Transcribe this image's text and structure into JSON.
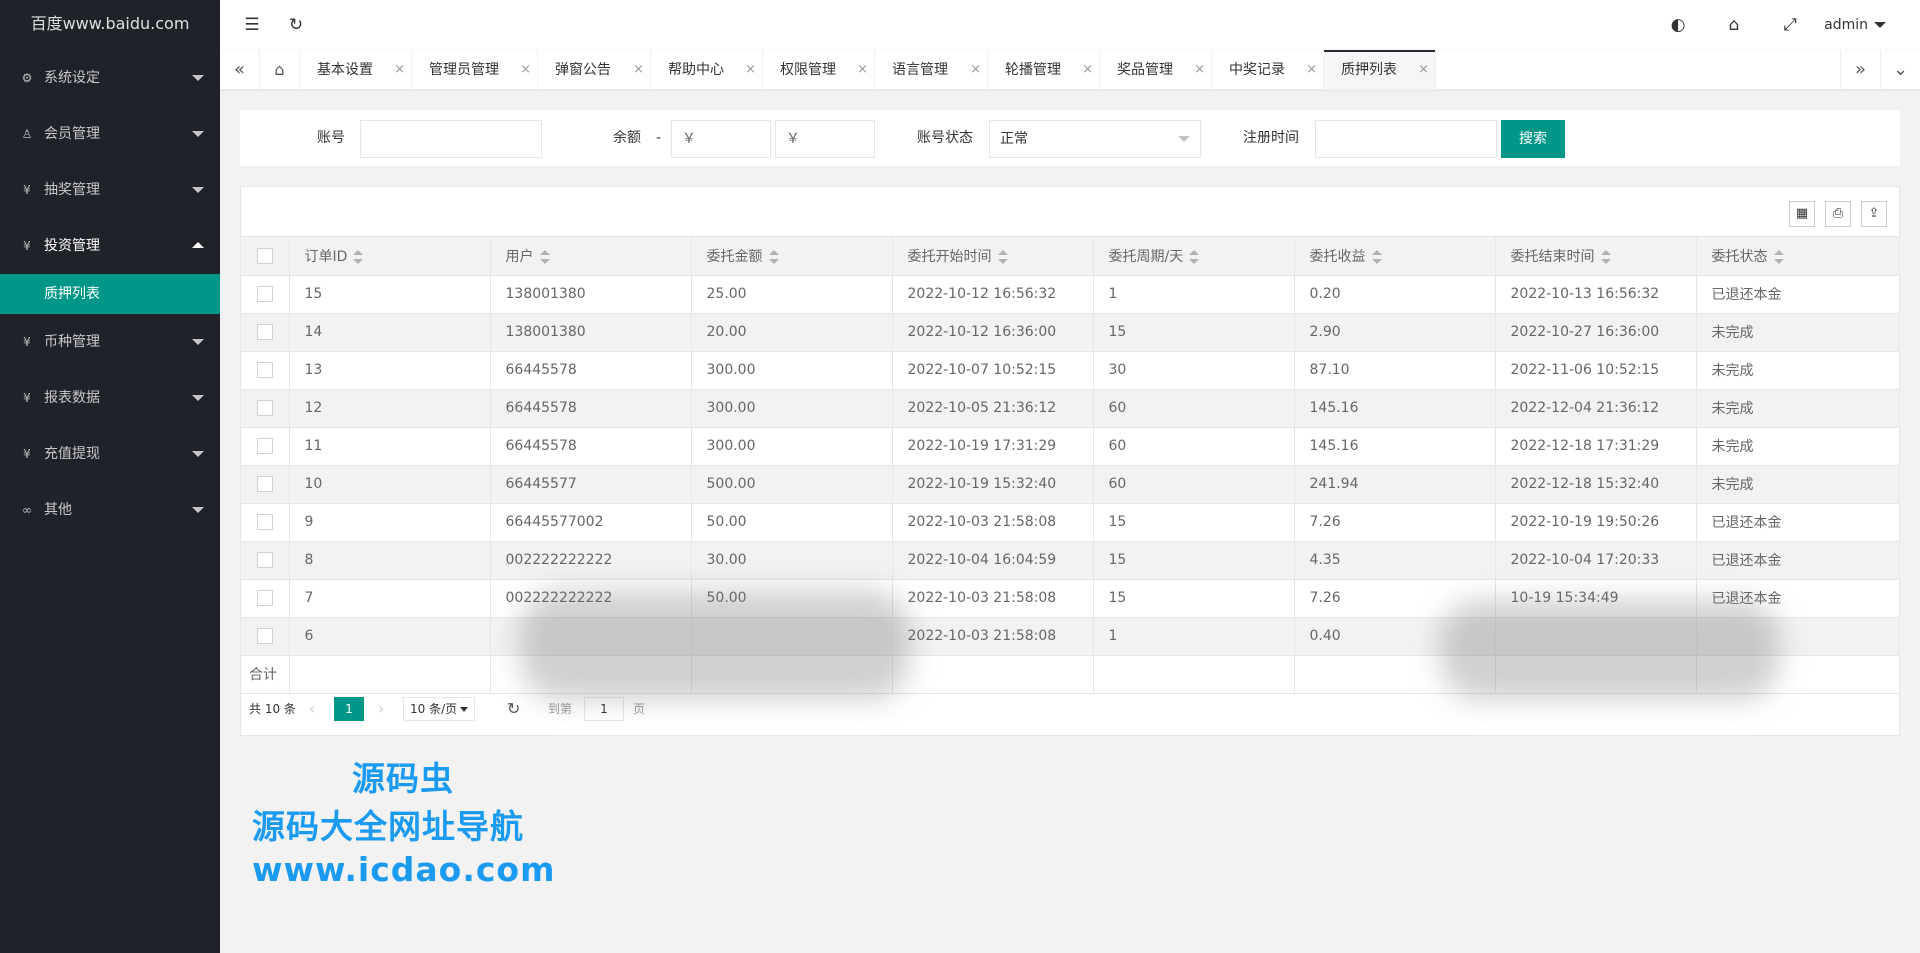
{
  "sidebar": {
    "logo": "百度www.baidu.com",
    "items": [
      {
        "label": "系统设定",
        "icon": "gear-icon",
        "glyph": "⚙"
      },
      {
        "label": "会员管理",
        "icon": "user-icon",
        "glyph": "♙"
      },
      {
        "label": "抽奖管理",
        "icon": "yen-circle-icon",
        "glyph": "¥"
      },
      {
        "label": "投资管理",
        "icon": "yen-circle-icon",
        "glyph": "¥"
      },
      {
        "label": "币种管理",
        "icon": "yen-circle-icon",
        "glyph": "¥"
      },
      {
        "label": "报表数据",
        "icon": "yen-circle-icon",
        "glyph": "¥"
      },
      {
        "label": "充值提现",
        "icon": "yen-circle-icon",
        "glyph": "¥"
      },
      {
        "label": "其他",
        "icon": "link-icon",
        "glyph": "∞"
      }
    ],
    "active_sub": "质押列表"
  },
  "header": {
    "menu_glyph": "☰",
    "refresh_glyph": "↻",
    "theme_glyph": "◐",
    "tag_glyph": "⌂",
    "fullscreen_glyph": "⤢",
    "user": "admin"
  },
  "tabs": {
    "prev_glyph": "«",
    "next_glyph": "»",
    "more_glyph": "⌄",
    "home_glyph": "⌂",
    "close_glyph": "×",
    "items": [
      "基本设置",
      "管理员管理",
      "弹窗公告",
      "帮助中心",
      "权限管理",
      "语言管理",
      "轮播管理",
      "奖品管理",
      "中奖记录",
      "质押列表"
    ]
  },
  "search": {
    "account_label": "账号",
    "balance_label": "余额",
    "dash": "-",
    "min_placeholder": "￥",
    "max_placeholder": "￥",
    "status_label": "账号状态",
    "status_value": "正常",
    "reg_time_label": "注册时间",
    "search_button": "搜索"
  },
  "table": {
    "columns": [
      "订单ID",
      "用户",
      "委托金额",
      "委托开始时间",
      "委托周期/天",
      "委托收益",
      "委托结束时间",
      "委托状态"
    ],
    "rows": [
      [
        "15",
        "138001380",
        "25.00",
        "2022-10-12 16:56:32",
        "1",
        "0.20",
        "2022-10-13 16:56:32",
        "已退还本金"
      ],
      [
        "14",
        "138001380",
        "20.00",
        "2022-10-12 16:36:00",
        "15",
        "2.90",
        "2022-10-27 16:36:00",
        "未完成"
      ],
      [
        "13",
        "66445578",
        "300.00",
        "2022-10-07 10:52:15",
        "30",
        "87.10",
        "2022-11-06 10:52:15",
        "未完成"
      ],
      [
        "12",
        "66445578",
        "300.00",
        "2022-10-05 21:36:12",
        "60",
        "145.16",
        "2022-12-04 21:36:12",
        "未完成"
      ],
      [
        "11",
        "66445578",
        "300.00",
        "2022-10-19 17:31:29",
        "60",
        "145.16",
        "2022-12-18 17:31:29",
        "未完成"
      ],
      [
        "10",
        "66445577",
        "500.00",
        "2022-10-19 15:32:40",
        "60",
        "241.94",
        "2022-12-18 15:32:40",
        "未完成"
      ],
      [
        "9",
        "66445577002",
        "50.00",
        "2022-10-03 21:58:08",
        "15",
        "7.26",
        "2022-10-19 19:50:26",
        "已退还本金"
      ],
      [
        "8",
        "002222222222",
        "30.00",
        "2022-10-04 16:04:59",
        "15",
        "4.35",
        "2022-10-04 17:20:33",
        "已退还本金"
      ],
      [
        "7",
        "002222222222",
        "50.00",
        "2022-10-03 21:58:08",
        "15",
        "7.26",
        "10-19 15:34:49",
        "已退还本金"
      ],
      [
        "6",
        "",
        "",
        "2022-10-03 21:58:08",
        "1",
        "0.40",
        "",
        ""
      ]
    ],
    "total_label": "合计"
  },
  "pager": {
    "total": "共 10 条",
    "prev_glyph": "‹",
    "next_glyph": "›",
    "current": "1",
    "size": "10 条/页",
    "refresh_glyph": "↻",
    "goto_label": "到第",
    "goto_value": "1",
    "page_label": "页"
  },
  "promo": {
    "line1": "源码虫",
    "line2": "源码大全网址导航",
    "line3": "www.icdao.com"
  },
  "colors": {
    "accent": "#009688",
    "sidebar_bg": "#20222a",
    "promo": "#1a9af0"
  }
}
